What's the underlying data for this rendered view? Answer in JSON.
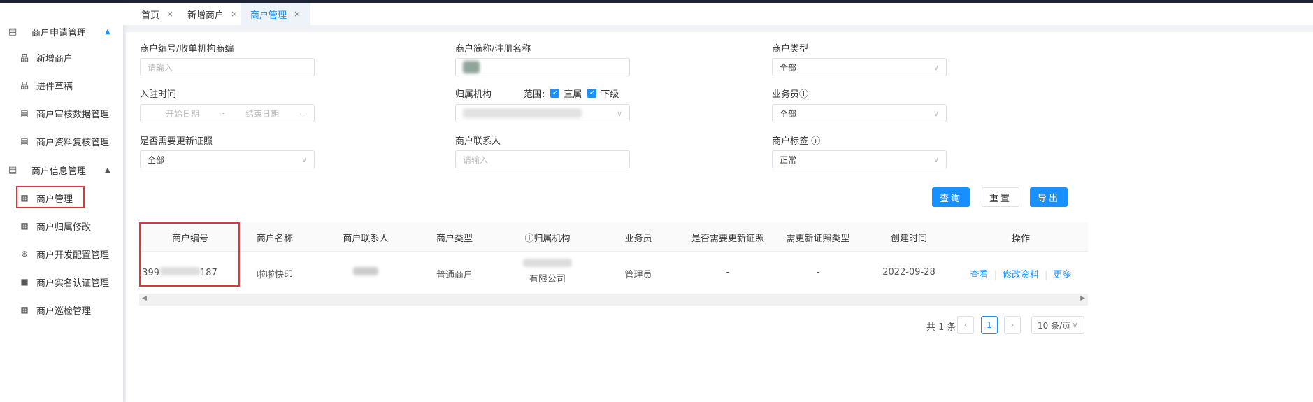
{
  "sidebar": {
    "groups": [
      {
        "label": "商户申请管理",
        "items": [
          "新增商户",
          "进件草稿",
          "商户审核数据管理",
          "商户资料复核管理"
        ]
      },
      {
        "label": "商户信息管理",
        "items": [
          "商户管理",
          "商户归属修改",
          "商户开发配置管理",
          "商户实名认证管理",
          "商户巡检管理"
        ]
      }
    ]
  },
  "tabs": [
    {
      "label": "首页"
    },
    {
      "label": "新增商户"
    },
    {
      "label": "商户管理",
      "active": true
    }
  ],
  "close_glyph": "×",
  "form": {
    "merchant_no": {
      "label": "商户编号/收单机构商编",
      "placeholder": "请输入"
    },
    "merchant_name": {
      "label": "商户简称/注册名称"
    },
    "merchant_type": {
      "label": "商户类型",
      "value": "全部"
    },
    "join_time": {
      "label": "入驻时间",
      "start": "开始日期",
      "sep": "~",
      "end": "结束日期"
    },
    "org": {
      "label": "归属机构",
      "scope_label": "范围:",
      "direct": "直属",
      "sub": "下级"
    },
    "salesman": {
      "label": "业务员",
      "value": "全部"
    },
    "need_update": {
      "label": "是否需要更新证照",
      "value": "全部"
    },
    "contact": {
      "label": "商户联系人",
      "placeholder": "请输入"
    },
    "tag": {
      "label": "商户标签",
      "value": "正常"
    }
  },
  "buttons": {
    "query": "查询",
    "reset": "重置",
    "export": "导出"
  },
  "table": {
    "headers": [
      "商户编号",
      "商户名称",
      "商户联系人",
      "商户类型",
      "归属机构",
      "业务员",
      "是否需要更新证照",
      "需更新证照类型",
      "创建时间",
      "操作"
    ],
    "rows": [
      {
        "merchant_no_prefix": "399",
        "merchant_no_suffix": "187",
        "name": "啦啦快印",
        "type": "普通商户",
        "org_suffix": "有限公司",
        "salesman": "管理员",
        "need_update": "-",
        "update_type": "-",
        "created": "2022-09-28",
        "actions": [
          "查看",
          "修改资料",
          "更多"
        ]
      }
    ]
  },
  "pagination": {
    "total": "共 1 条",
    "page": "1",
    "page_size": "10 条/页"
  }
}
